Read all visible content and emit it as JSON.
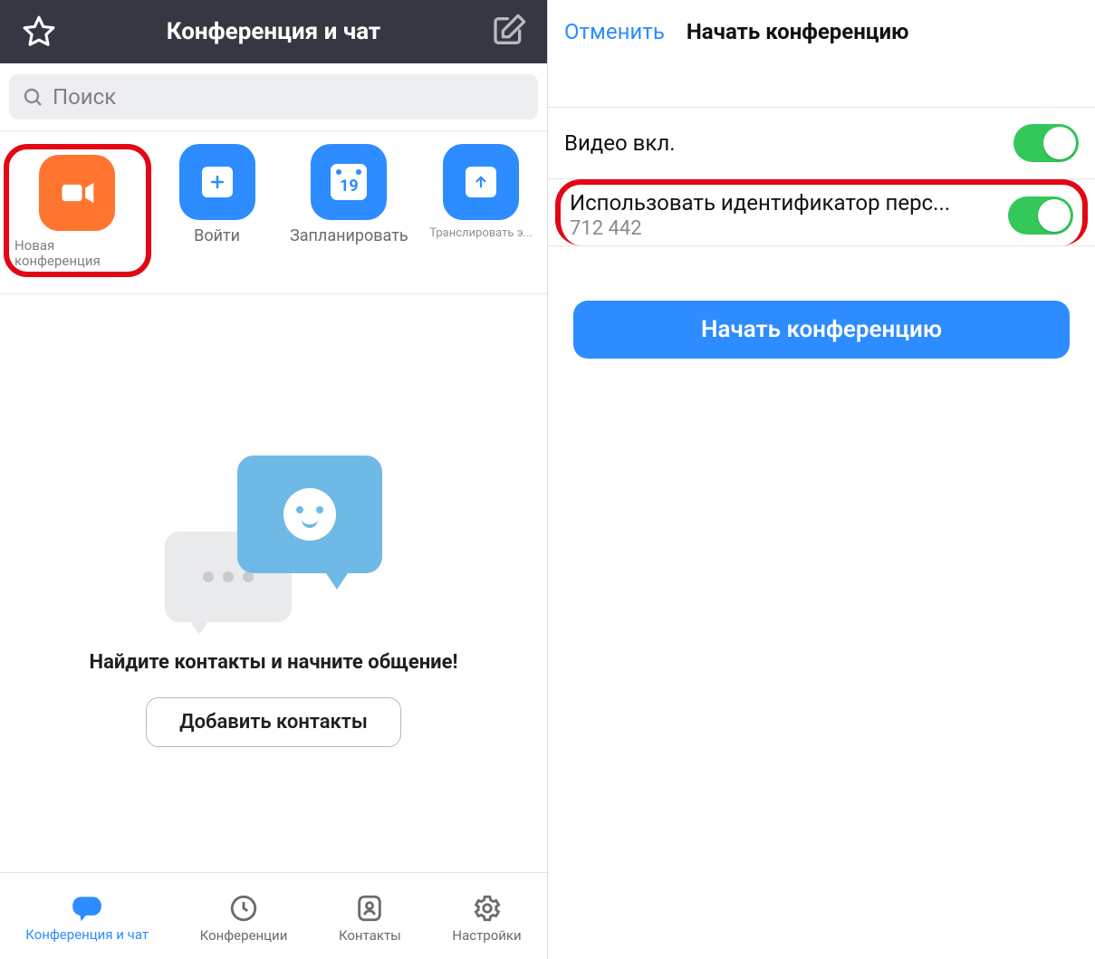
{
  "left": {
    "header_title": "Конференция и чат",
    "search_placeholder": "Поиск",
    "actions": {
      "new_meeting": "Новая конференция",
      "join": "Войти",
      "schedule": "Запланировать",
      "schedule_day": "19",
      "share": "Транслировать э..."
    },
    "empty": {
      "prompt": "Найдите контакты и начните общение!",
      "add_contacts": "Добавить контакты"
    },
    "tabs": {
      "chat": "Конференция и чат",
      "meetings": "Конференции",
      "contacts": "Контакты",
      "settings": "Настройки"
    }
  },
  "right": {
    "cancel": "Отменить",
    "title": "Начать конференцию",
    "video_on": "Видео вкл.",
    "use_pmi_label": "Использовать идентификатор перс...",
    "use_pmi_value": "712 442",
    "start_button": "Начать конференцию"
  }
}
